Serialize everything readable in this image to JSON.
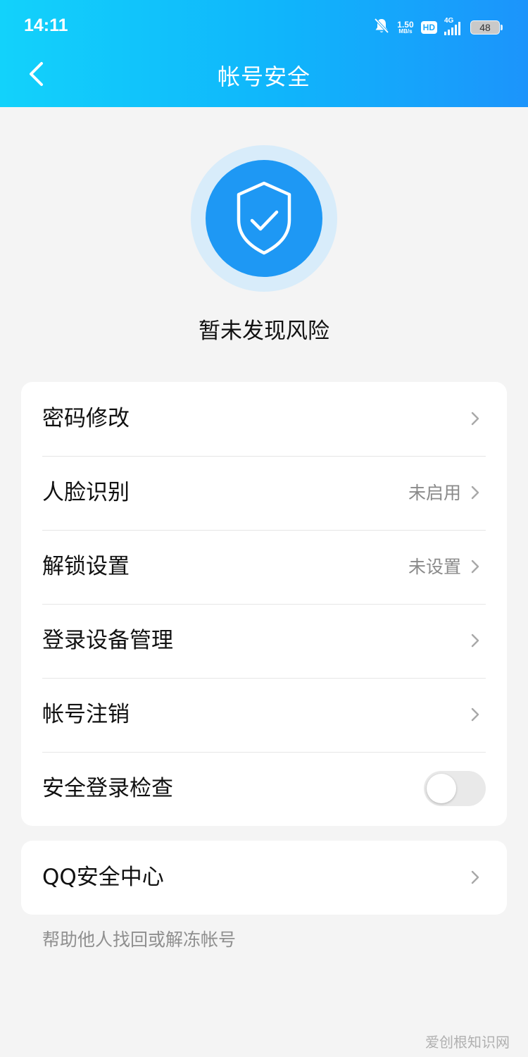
{
  "status_bar": {
    "time": "14:11",
    "net_speed_value": "1.50",
    "net_speed_unit": "MB/s",
    "hd_label": "HD",
    "network_type": "4G",
    "battery_level": "48",
    "icons": [
      "bell-off-icon",
      "signal-icon",
      "battery-icon"
    ]
  },
  "header": {
    "title": "帐号安全",
    "back_icon": "chevron-left-icon"
  },
  "hero": {
    "icon": "shield-check-icon",
    "status_text": "暂未发现风险"
  },
  "settings_card": {
    "items": [
      {
        "label": "密码修改",
        "value": "",
        "icon": "chevron-right-icon"
      },
      {
        "label": "人脸识别",
        "value": "未启用",
        "icon": "chevron-right-icon"
      },
      {
        "label": "解锁设置",
        "value": "未设置",
        "icon": "chevron-right-icon"
      },
      {
        "label": "登录设备管理",
        "value": "",
        "icon": "chevron-right-icon"
      },
      {
        "label": "帐号注销",
        "value": "",
        "icon": "chevron-right-icon"
      },
      {
        "label": "安全登录检查",
        "toggle_on": false
      }
    ]
  },
  "security_center": {
    "label": "QQ安全中心",
    "icon": "chevron-right-icon"
  },
  "help_link": "帮助他人找回或解冻帐号",
  "watermark": "爱创根知识网",
  "colors": {
    "header_start": "#12d2fb",
    "header_end": "#1c94fb",
    "shield_blue": "#1e98f4",
    "shield_halo": "#d8ecfa",
    "background": "#f4f4f4"
  }
}
